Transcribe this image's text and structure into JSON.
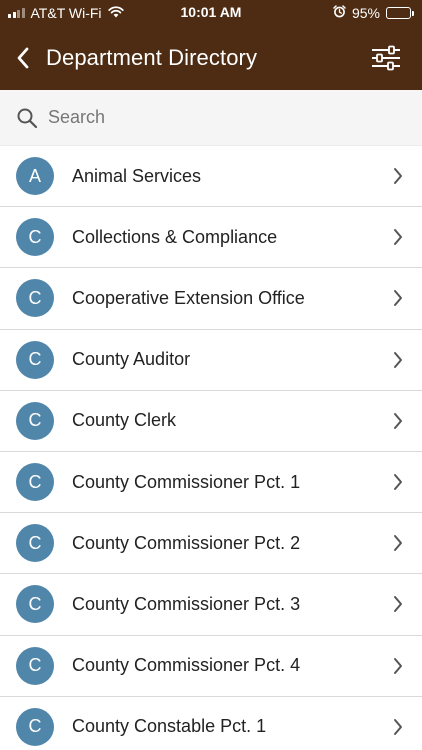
{
  "status_bar": {
    "carrier": "AT&T Wi-Fi",
    "time": "10:01 AM",
    "battery_percent": "95%",
    "battery_level": 0.95,
    "icons": [
      "signal-icon",
      "wifi-icon",
      "alarm-icon",
      "battery-icon"
    ]
  },
  "header": {
    "title": "Department Directory",
    "back_icon": "chevron-left-icon",
    "filter_icon": "sliders-icon",
    "background_color": "#4e2c14"
  },
  "search": {
    "placeholder": "Search",
    "value": "",
    "icon": "search-icon"
  },
  "avatar_color": "#4f86aa",
  "departments": [
    {
      "initial": "A",
      "name": "Animal Services"
    },
    {
      "initial": "C",
      "name": "Collections & Compliance"
    },
    {
      "initial": "C",
      "name": "Cooperative Extension Office"
    },
    {
      "initial": "C",
      "name": "County Auditor"
    },
    {
      "initial": "C",
      "name": "County Clerk"
    },
    {
      "initial": "C",
      "name": "County Commissioner Pct. 1"
    },
    {
      "initial": "C",
      "name": "County Commissioner Pct. 2"
    },
    {
      "initial": "C",
      "name": "County Commissioner Pct. 3"
    },
    {
      "initial": "C",
      "name": "County Commissioner Pct. 4"
    },
    {
      "initial": "C",
      "name": "County Constable Pct. 1"
    }
  ]
}
